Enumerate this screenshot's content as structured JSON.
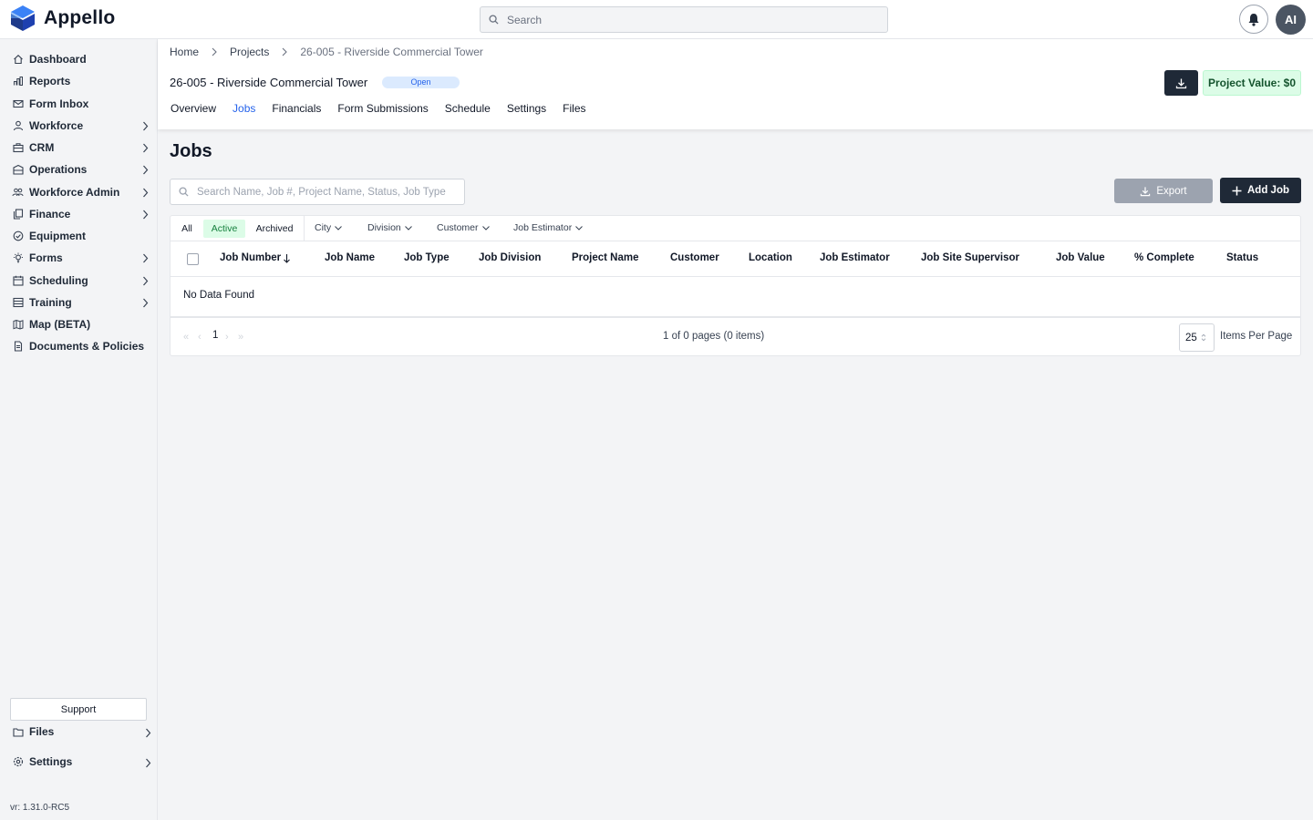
{
  "app": {
    "name": "Appello",
    "version": "vr: 1.31.0-RC5"
  },
  "topbar": {
    "search_placeholder": "Search",
    "avatar_initials": "AI"
  },
  "sidebar": {
    "items": [
      {
        "label": "Dashboard",
        "icon": "home-icon",
        "expandable": false
      },
      {
        "label": "Reports",
        "icon": "chart-icon",
        "expandable": false
      },
      {
        "label": "Form Inbox",
        "icon": "mail-icon",
        "expandable": false
      },
      {
        "label": "Workforce",
        "icon": "user-icon",
        "expandable": true
      },
      {
        "label": "CRM",
        "icon": "briefcase-icon",
        "expandable": true
      },
      {
        "label": "Operations",
        "icon": "building-icon",
        "expandable": true
      },
      {
        "label": "Workforce Admin",
        "icon": "users-icon",
        "expandable": true
      },
      {
        "label": "Finance",
        "icon": "copy-icon",
        "expandable": true
      },
      {
        "label": "Equipment",
        "icon": "check-circle-icon",
        "expandable": false
      },
      {
        "label": "Forms",
        "icon": "bulb-icon",
        "expandable": true
      },
      {
        "label": "Scheduling",
        "icon": "calendar-icon",
        "expandable": true
      },
      {
        "label": "Training",
        "icon": "table-icon",
        "expandable": true
      },
      {
        "label": "Map (BETA)",
        "icon": "map-icon",
        "expandable": false
      },
      {
        "label": "Documents & Policies",
        "icon": "document-icon",
        "expandable": false
      }
    ],
    "support_label": "Support",
    "files_label": "Files",
    "settings_label": "Settings"
  },
  "breadcrumb": [
    "Home",
    "Projects",
    "26-005 - Riverside Commercial Tower"
  ],
  "project": {
    "title": "26-005 - Riverside Commercial Tower",
    "status": "Open",
    "value_label": "Project Value: $0",
    "tabs": [
      "Overview",
      "Jobs",
      "Financials",
      "Form Submissions",
      "Schedule",
      "Settings",
      "Files"
    ],
    "active_tab": "Jobs"
  },
  "jobs": {
    "page_title": "Jobs",
    "search_placeholder": "Search Name, Job #, Project Name, Status, Job Type",
    "export_label": "Export",
    "add_label": "Add Job",
    "segments": [
      "All",
      "Active",
      "Archived"
    ],
    "active_segment": "Active",
    "filters": [
      "City",
      "Division",
      "Customer",
      "Job Estimator"
    ],
    "columns": [
      "Job Number",
      "Job Name",
      "Job Type",
      "Job Division",
      "Project Name",
      "Customer",
      "Location",
      "Job Estimator",
      "Job Site Supervisor",
      "Job Value",
      "% Complete",
      "Status"
    ],
    "sorted_column": "Job Number",
    "sort_direction": "descending",
    "empty_text": "No Data Found",
    "pagination": {
      "current_page": "1",
      "info": "1 of 0 pages (0 items)",
      "page_size": "25",
      "page_size_label": "Items Per Page"
    }
  },
  "colors": {
    "accent": "#2563eb",
    "dark_button": "#1f2937",
    "active_green_bg": "#dcfce7",
    "active_green_text": "#15803d",
    "logo_blue": "#2563eb"
  }
}
